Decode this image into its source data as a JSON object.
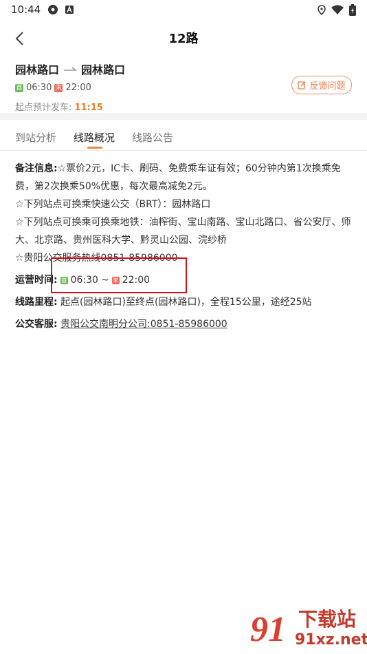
{
  "status_bar": {
    "time": "10:44",
    "icons": [
      "location-icon",
      "wifi-icon",
      "battery-icon"
    ]
  },
  "header": {
    "title": "12路",
    "back_icon": "chevron-left-icon"
  },
  "route": {
    "from": "园林路口",
    "to": "园林路口",
    "first_bus_badge": "首",
    "first_bus": "06:30",
    "last_bus_badge": "末",
    "last_bus": "22:00",
    "departure_label": "起点预计发车:",
    "departure_time": "11:15",
    "feedback_label": "反馈问题"
  },
  "tabs": [
    {
      "label": "到站分析",
      "active": false
    },
    {
      "label": "线路概况",
      "active": true
    },
    {
      "label": "线路公告",
      "active": false
    }
  ],
  "details": {
    "notes_label": "备注信息:",
    "notes": [
      "☆票价2元，IC卡、刷码、免费乘车证有效；60分钟内第1次换乘免费，第2次换乘50%优惠，每次最高减免2元。",
      "☆下列站点可换乘快速公交（BRT）：园林路口",
      "☆下列站点可换乘可换乘地铁：油榨街、宝山南路、宝山北路口、省公安厅、师大、北京路、贵州医科大学、黔灵山公园、浣纱桥",
      "☆贵阳公交服务热线0851-85986000"
    ],
    "op_time_label": "运营时间:",
    "op_start_badge": "首",
    "op_start": "06:30",
    "op_sep": "~",
    "op_end_badge": "末",
    "op_end": "22:00",
    "distance_label": "线路里程:",
    "distance": "起点(园林路口)至终点(园林路口)，全程15公里，途经25站",
    "service_label": "公交客服:",
    "service": "贵阳公交南明分公司:0851-85986000"
  },
  "watermark": {
    "number": "91",
    "name": "下载站",
    "domain": "91xz.net"
  },
  "colors": {
    "accent": "#f08a3c",
    "highlight_box": "#d10f1b"
  }
}
